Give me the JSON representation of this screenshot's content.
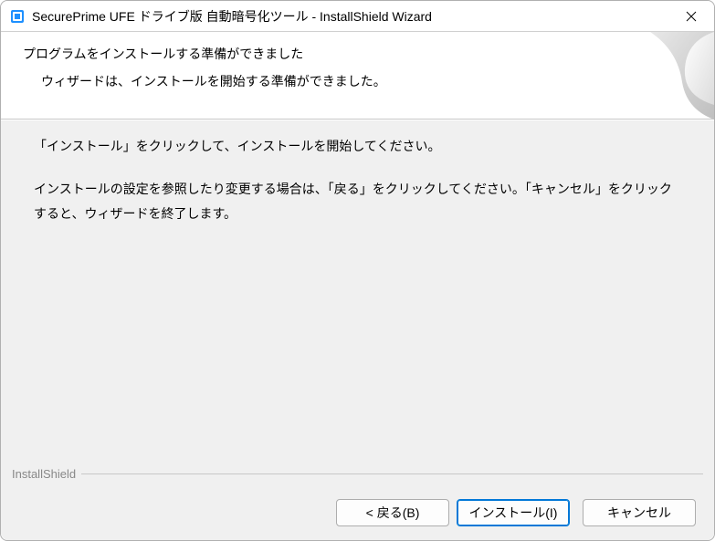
{
  "titlebar": {
    "title": "SecurePrime UFE ドライブ版 自動暗号化ツール - InstallShield Wizard"
  },
  "header": {
    "heading": "プログラムをインストールする準備ができました",
    "subheading": "ウィザードは、インストールを開始する準備ができました。"
  },
  "body": {
    "instruction": "「インストール」をクリックして、インストールを開始してください。",
    "note": "インストールの設定を参照したり変更する場合は、「戻る」をクリックしてください。「キャンセル」をクリックすると、ウィザードを終了します。"
  },
  "brand": "InstallShield",
  "footer": {
    "back_label": "< 戻る(B)",
    "install_label": "インストール(I)",
    "cancel_label": "キャンセル"
  }
}
